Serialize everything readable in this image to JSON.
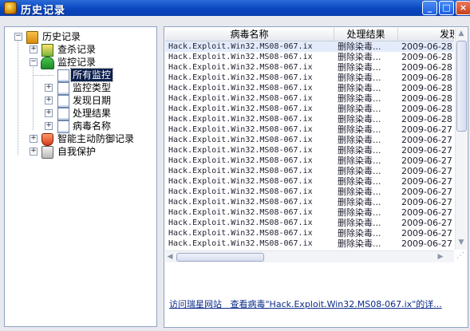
{
  "window": {
    "title": "历史记录",
    "buttons": [
      "_",
      "□",
      "×"
    ]
  },
  "tree": {
    "root": "历史记录",
    "items": [
      {
        "label": "查杀记录",
        "expander": "+"
      },
      {
        "label": "监控记录",
        "expander": "−"
      },
      {
        "label": "所有监控",
        "expander": ""
      },
      {
        "label": "监控类型",
        "expander": "+"
      },
      {
        "label": "发现日期",
        "expander": "+"
      },
      {
        "label": "处理结果",
        "expander": "+"
      },
      {
        "label": "病毒名称",
        "expander": "+"
      },
      {
        "label": "智能主动防御记录",
        "expander": "+"
      },
      {
        "label": "自我保护",
        "expander": "+"
      }
    ],
    "root_expander": "−"
  },
  "list": {
    "columns": [
      "病毒名称",
      "处理结果",
      "发现"
    ],
    "rows": [
      [
        "Hack.Exploit.Win32.MS08-067.ix",
        "删除染毒...",
        "2009-06-28"
      ],
      [
        "Hack.Exploit.Win32.MS08-067.ix",
        "删除染毒...",
        "2009-06-28"
      ],
      [
        "Hack.Exploit.Win32.MS08-067.ix",
        "删除染毒...",
        "2009-06-28"
      ],
      [
        "Hack.Exploit.Win32.MS08-067.ix",
        "删除染毒...",
        "2009-06-28"
      ],
      [
        "Hack.Exploit.Win32.MS08-067.ix",
        "删除染毒...",
        "2009-06-28"
      ],
      [
        "Hack.Exploit.Win32.MS08-067.ix",
        "删除染毒...",
        "2009-06-28"
      ],
      [
        "Hack.Exploit.Win32.MS08-067.ix",
        "删除染毒...",
        "2009-06-28"
      ],
      [
        "Hack.Exploit.Win32.MS08-067.ix",
        "删除染毒...",
        "2009-06-28"
      ],
      [
        "Hack.Exploit.Win32.MS08-067.ix",
        "删除染毒...",
        "2009-06-27"
      ],
      [
        "Hack.Exploit.Win32.MS08-067.ix",
        "删除染毒...",
        "2009-06-27"
      ],
      [
        "Hack.Exploit.Win32.MS08-067.ix",
        "删除染毒...",
        "2009-06-27"
      ],
      [
        "Hack.Exploit.Win32.MS08-067.ix",
        "删除染毒...",
        "2009-06-27"
      ],
      [
        "Hack.Exploit.Win32.MS08-067.ix",
        "删除染毒...",
        "2009-06-27"
      ],
      [
        "Hack.Exploit.Win32.MS08-067.ix",
        "删除染毒...",
        "2009-06-27"
      ],
      [
        "Hack.Exploit.Win32.MS08-067.ix",
        "删除染毒...",
        "2009-06-27"
      ],
      [
        "Hack.Exploit.Win32.MS08-067.ix",
        "删除染毒...",
        "2009-06-27"
      ],
      [
        "Hack.Exploit.Win32.MS08-067.ix",
        "删除染毒...",
        "2009-06-27"
      ],
      [
        "Hack.Exploit.Win32.MS08-067.ix",
        "删除染毒...",
        "2009-06-27"
      ],
      [
        "Hack.Exploit.Win32.MS08-067.ix",
        "删除染毒...",
        "2009-06-27"
      ],
      [
        "Hack.Exploit.Win32.MS08-067.ix",
        "删除染毒...",
        "2009-06-27"
      ]
    ]
  },
  "status": {
    "link1": "访问瑞星网站",
    "link2": "查看病毒\"Hack.Exploit.Win32.MS08-067.ix\"的详..."
  },
  "colors": {
    "titlebar": "#0a46c0",
    "selected_tree": "#0b1f4d",
    "selected_row": "#e4ecfb",
    "link": "#0b2a8a"
  }
}
